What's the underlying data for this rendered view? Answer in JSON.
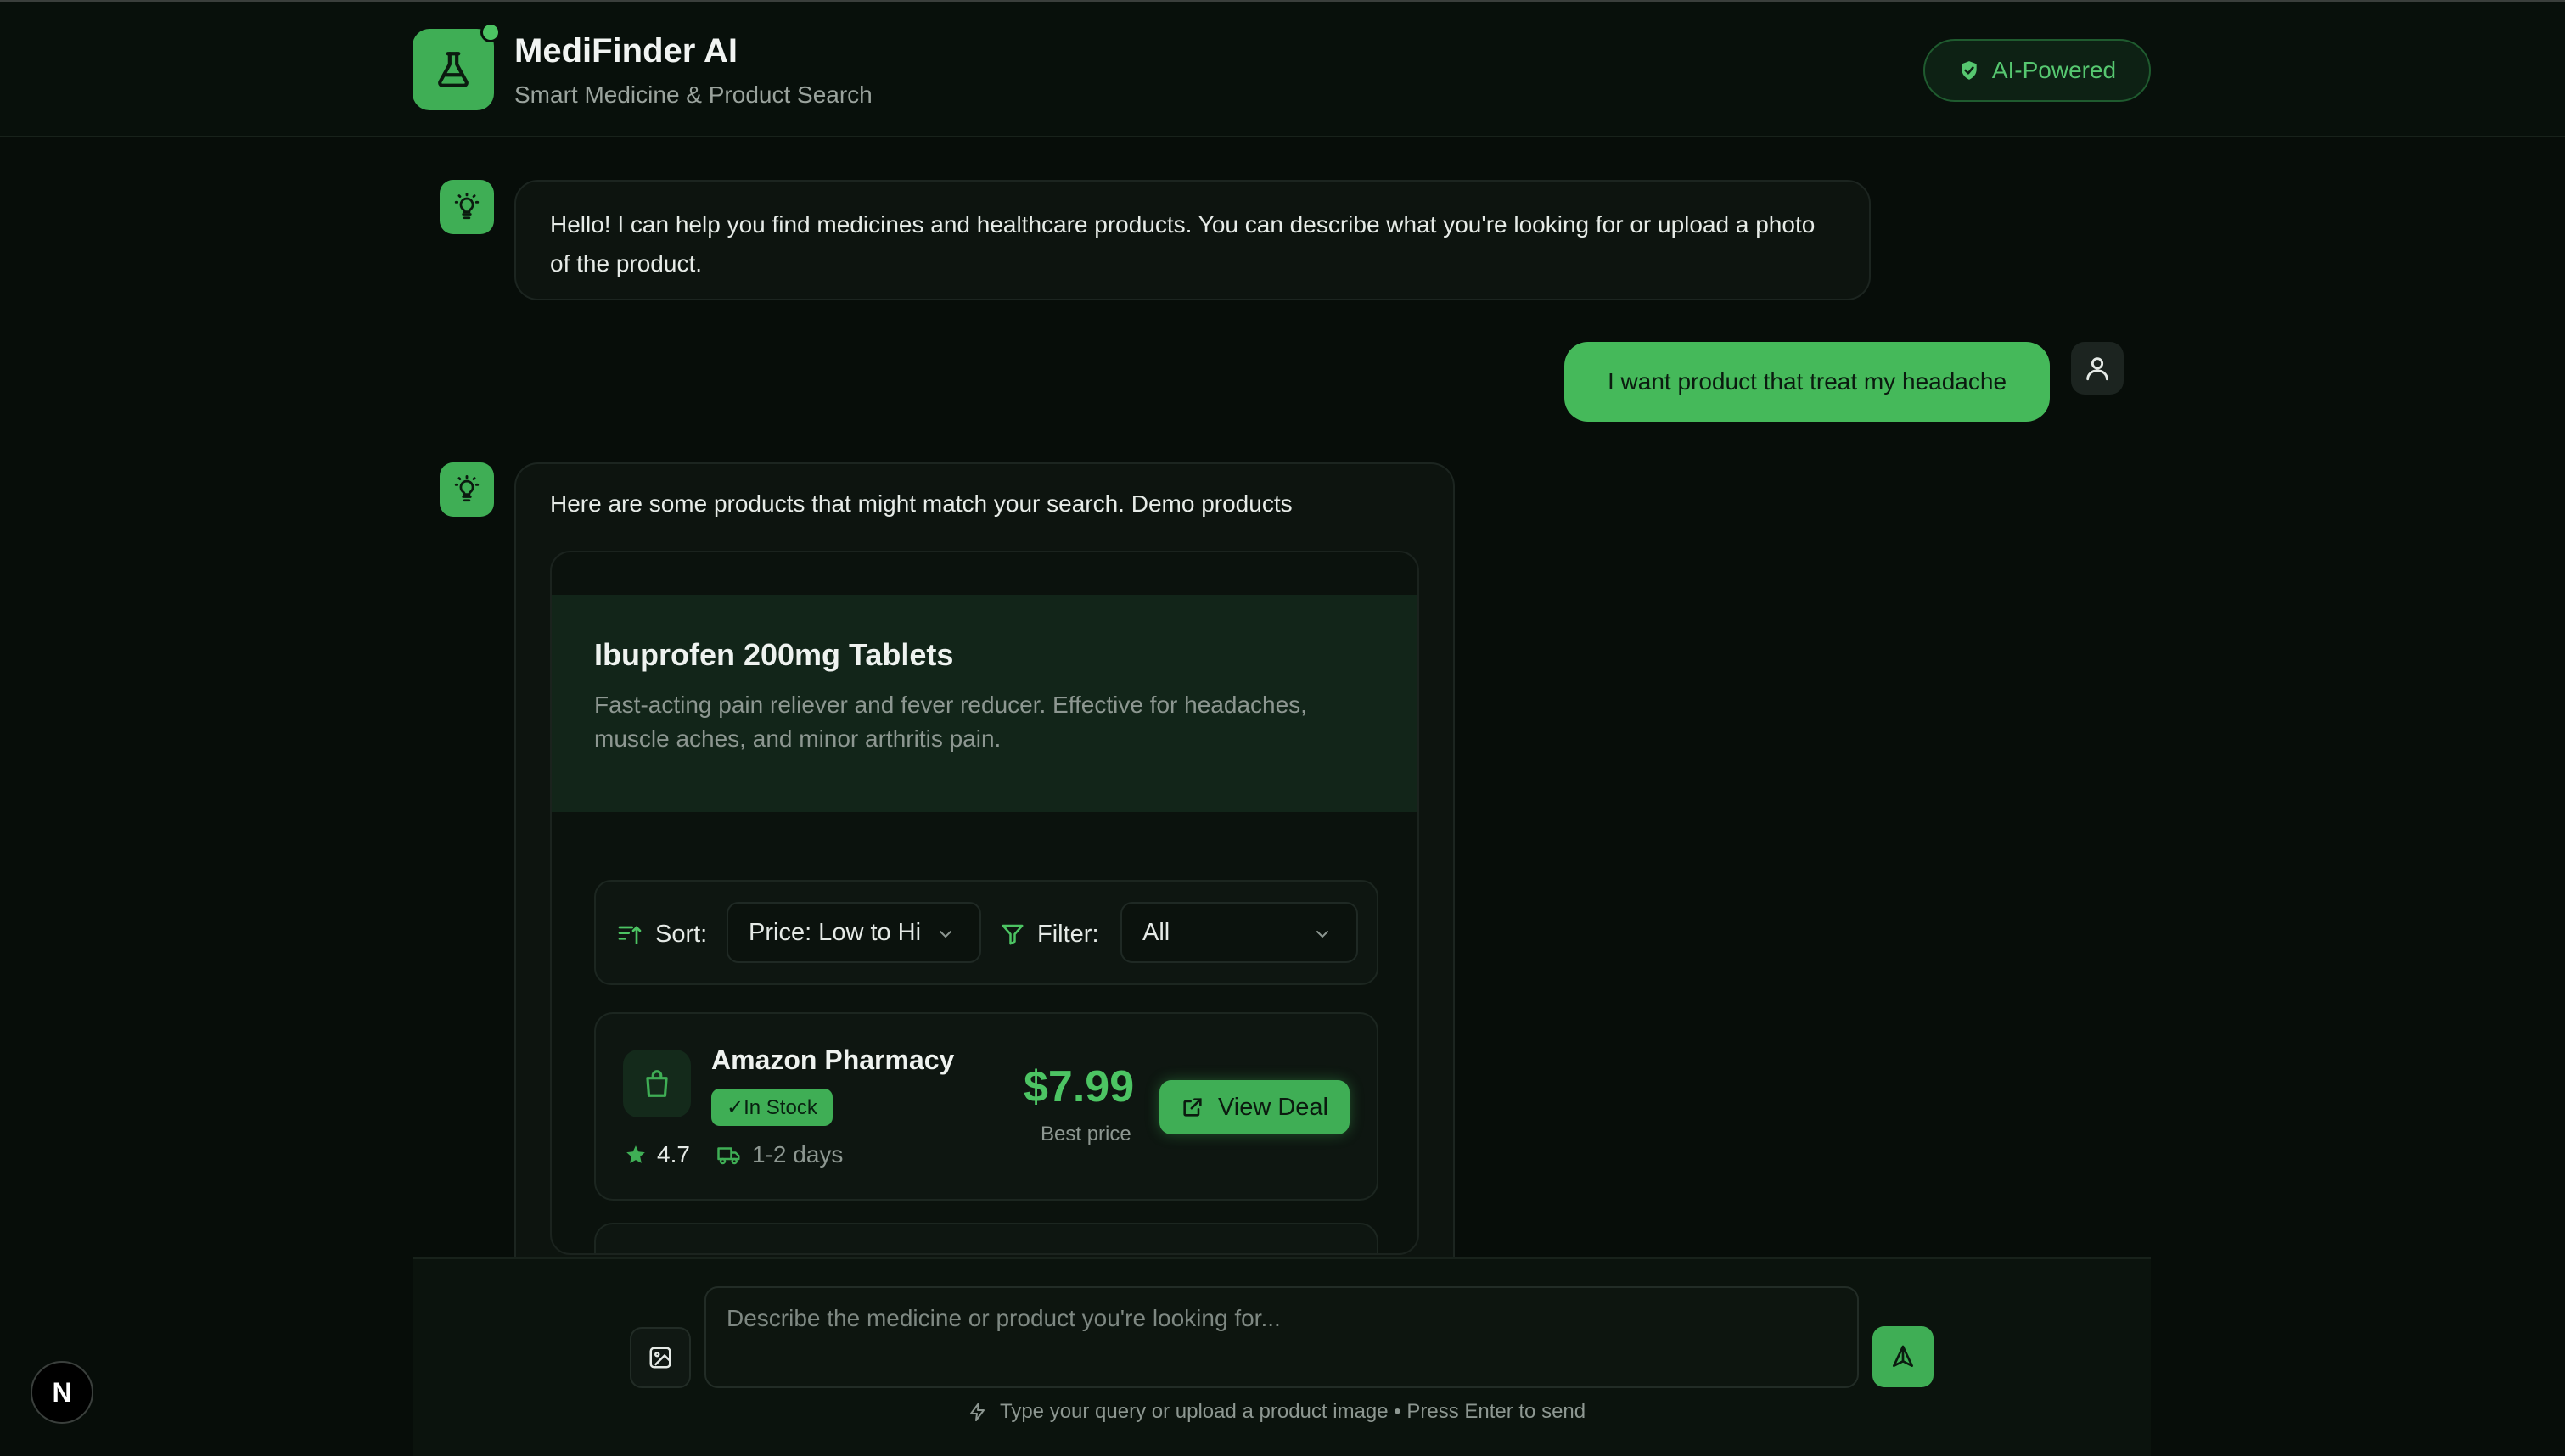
{
  "app": {
    "title": "MediFinder AI",
    "subtitle": "Smart Medicine & Product Search",
    "badge": "AI-Powered"
  },
  "chat": {
    "greeting": "Hello! I can help you find medicines and healthcare products. You can describe what you're looking for or upload a photo of the product.",
    "user_message": "I want product that treat my headache",
    "results_intro": "Here are some products that might match your search. Demo products"
  },
  "product": {
    "name": "Ibuprofen 200mg Tablets",
    "description": "Fast-acting pain reliever and fever reducer. Effective for headaches, muscle aches, and minor arthritis pain."
  },
  "toolbar": {
    "sort_label": "Sort:",
    "sort_value": "Price: Low to Hi",
    "filter_label": "Filter:",
    "filter_value": "All"
  },
  "stores": [
    {
      "name": "Amazon Pharmacy",
      "stock": "✓In Stock",
      "rating": "4.7",
      "shipping": "1-2 days",
      "price": "$7.99",
      "price_note": "Best price",
      "action": "View Deal"
    }
  ],
  "composer": {
    "placeholder": "Describe the medicine or product you're looking for...",
    "hint": "Type your query or upload a product image • Press Enter to send"
  },
  "colors": {
    "accent": "#3fae55",
    "background": "#070d09"
  },
  "icons": [
    "flask-icon",
    "shield-check-icon",
    "lightbulb-icon",
    "user-icon",
    "sort-icon",
    "filter-icon",
    "chevron-down-icon",
    "shopping-bag-icon",
    "star-icon",
    "truck-icon",
    "external-link-icon",
    "image-icon",
    "send-icon",
    "zap-icon"
  ]
}
